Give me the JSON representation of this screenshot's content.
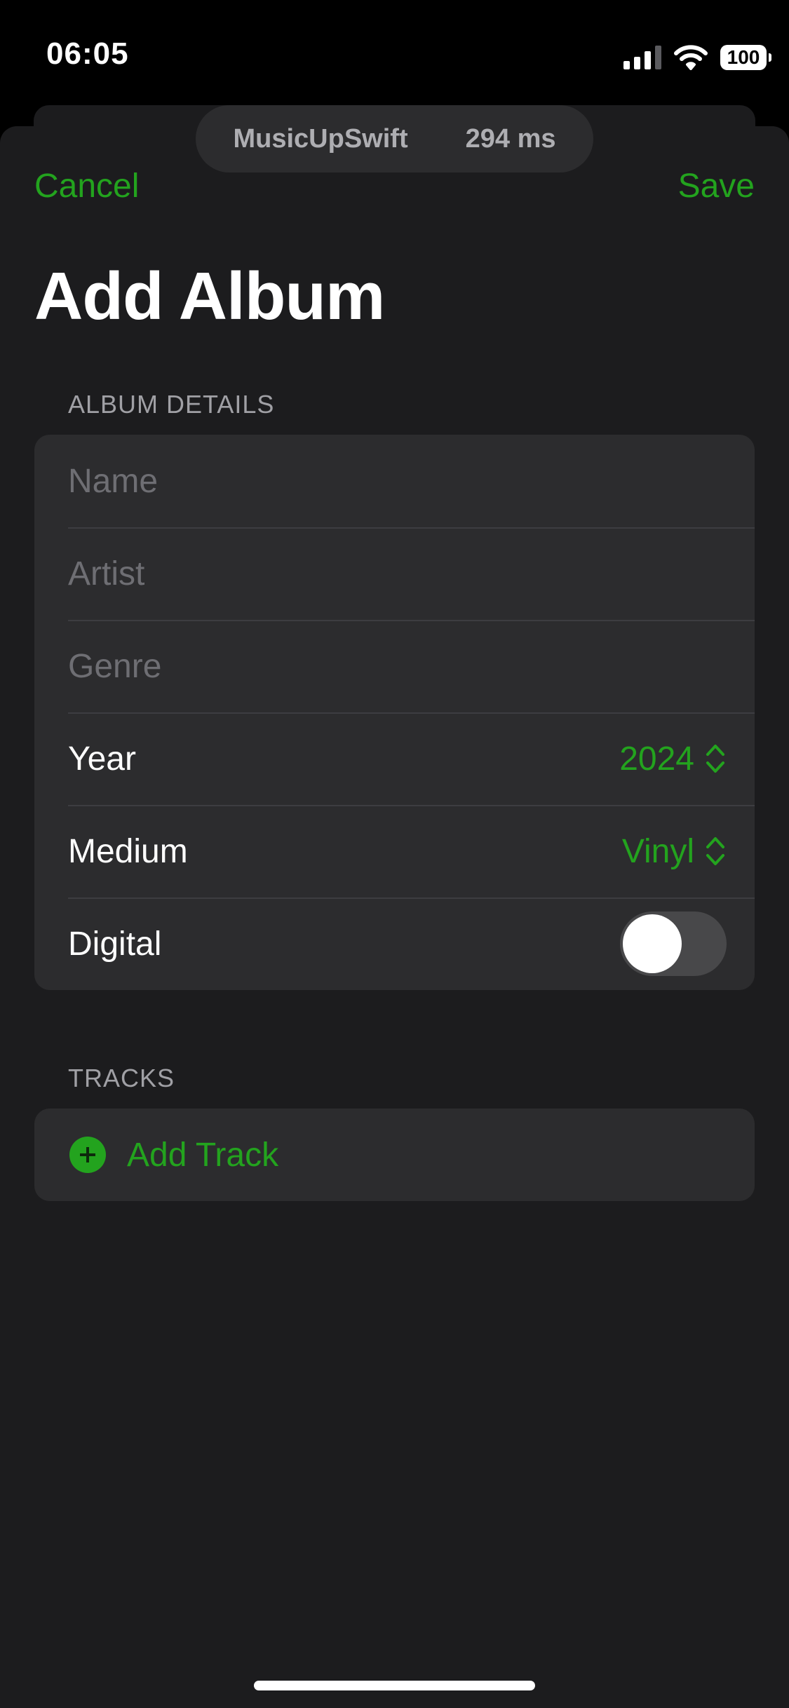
{
  "status_bar": {
    "time": "06:05",
    "battery": "100",
    "icons": [
      "cellular-signal-icon",
      "wifi-icon",
      "battery-icon"
    ]
  },
  "debug_pill": {
    "app_name": "MusicUpSwift",
    "latency": "294 ms"
  },
  "nav": {
    "cancel_label": "Cancel",
    "save_label": "Save",
    "accent_color": "#23a31e"
  },
  "title": "Add Album",
  "album_details": {
    "header": "ALBUM DETAILS",
    "name_placeholder": "Name",
    "artist_placeholder": "Artist",
    "genre_placeholder": "Genre",
    "year_label": "Year",
    "year_value": "2024",
    "medium_label": "Medium",
    "medium_value": "Vinyl",
    "digital_label": "Digital",
    "digital_on": false
  },
  "tracks": {
    "header": "TRACKS",
    "add_track_label": "Add Track"
  }
}
